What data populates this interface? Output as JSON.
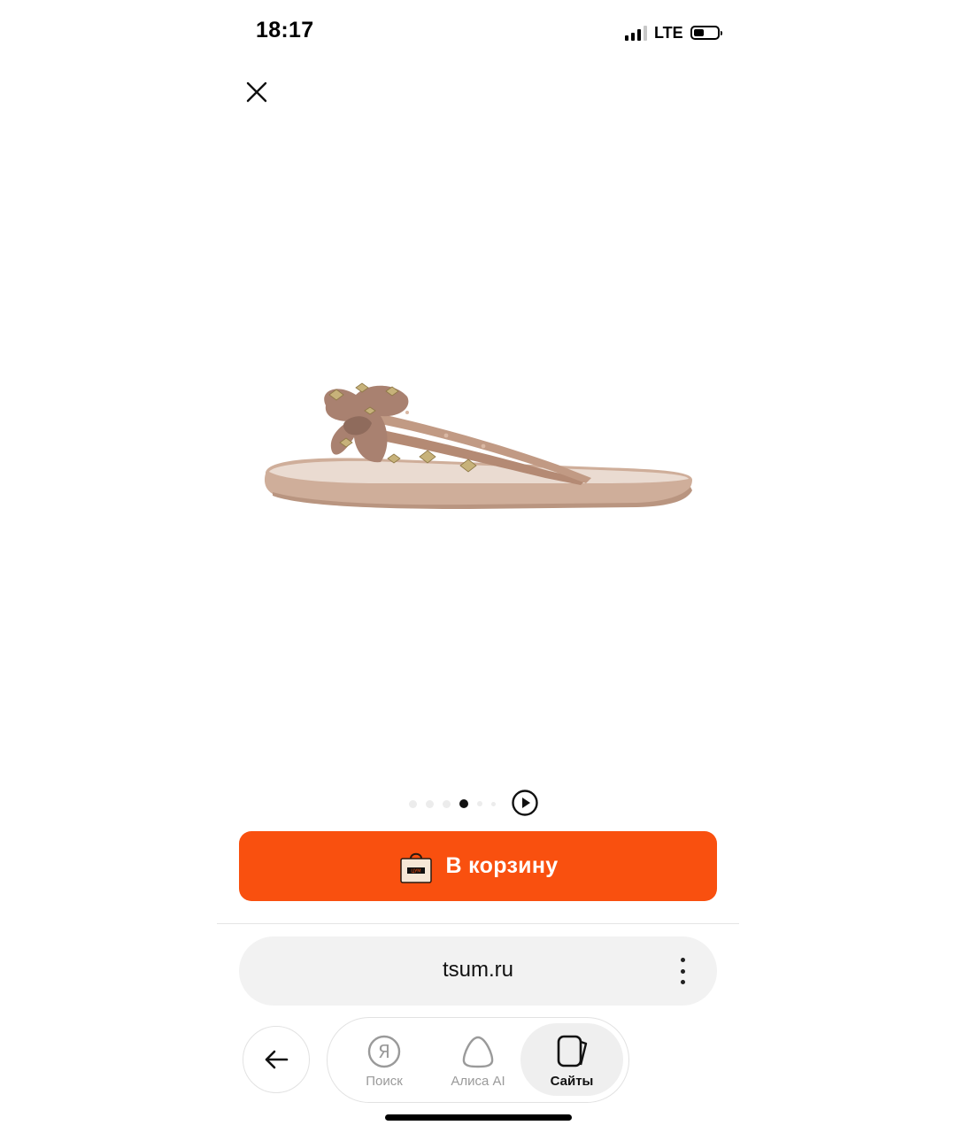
{
  "status_bar": {
    "time": "18:17",
    "network": "LTE",
    "signal_bars": 3,
    "battery_percent": 35
  },
  "viewer": {
    "close_icon": "close-icon",
    "image_description_icon": "product-photo",
    "gallery": {
      "count": 6,
      "active_index": 3
    },
    "play_icon": "play-icon"
  },
  "cart_button": {
    "label": "В корзину",
    "icon": "shopping-bag-icon",
    "color": "#f9500f"
  },
  "browser": {
    "address": "tsum.ru",
    "menu_icon": "more-vertical-icon",
    "back_icon": "arrow-left-icon",
    "nav": [
      {
        "label": "Поиск",
        "icon": "yandex-search-icon",
        "active": false
      },
      {
        "label": "Алиса AI",
        "icon": "alice-icon",
        "active": false
      },
      {
        "label": "Сайты",
        "icon": "tabs-icon",
        "active": true
      }
    ]
  }
}
